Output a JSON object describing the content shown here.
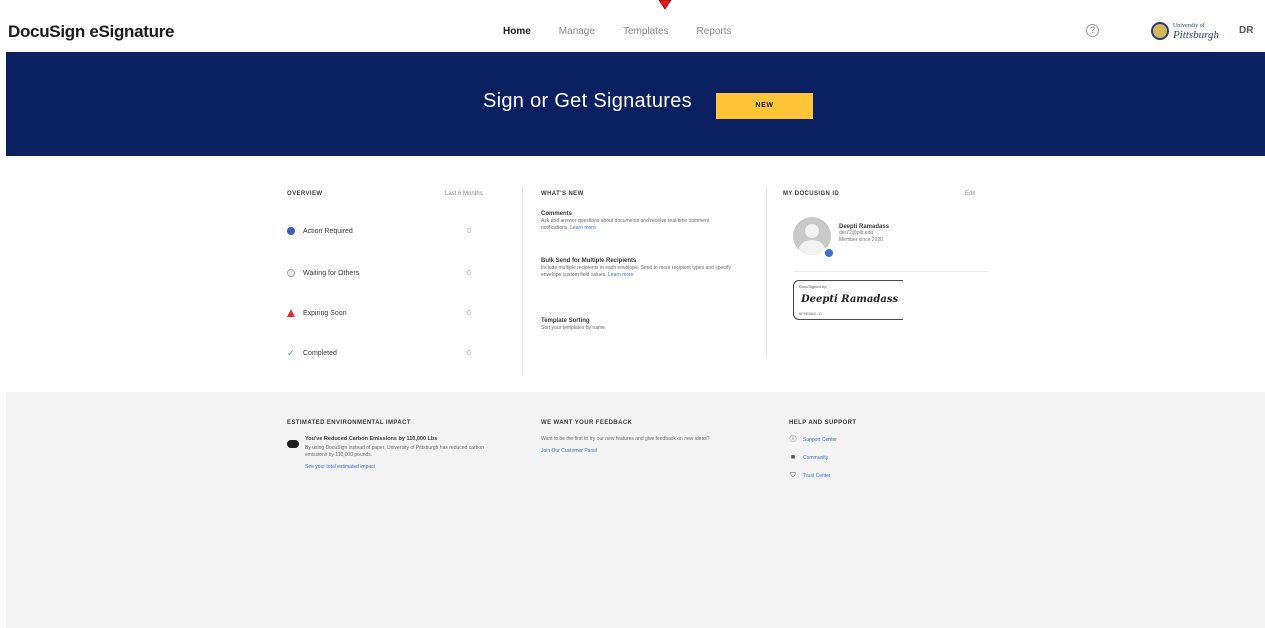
{
  "header": {
    "brand": "DocuSign eSignature",
    "nav": [
      "Home",
      "Manage",
      "Templates",
      "Reports"
    ],
    "active_tab": "Home",
    "help_glyph": "?",
    "org": {
      "line1": "University of",
      "line2": "Pittsburgh"
    },
    "user_initials": "DR"
  },
  "banner": {
    "title": "Sign or Get Signatures",
    "new_button": "NEW",
    "bg_color": "#0b2060",
    "accent_color": "#ffc43a"
  },
  "overview": {
    "title": "OVERVIEW",
    "range": "Last 6 Months",
    "rows": [
      {
        "label": "Action Required",
        "count": "0",
        "icon": "blue-dot-icon"
      },
      {
        "label": "Waiting for Others",
        "count": "0",
        "icon": "grey-dot-icon"
      },
      {
        "label": "Expiring Soon",
        "count": "0",
        "icon": "warning-triangle-icon"
      },
      {
        "label": "Completed",
        "count": "0",
        "icon": "check-icon"
      }
    ]
  },
  "whats_new": {
    "title": "WHAT'S NEW",
    "items": [
      {
        "title": "Comments",
        "desc": "Ask and answer questions about documents and receive real-time comment notifications.",
        "link": "Learn more"
      },
      {
        "title": "Bulk Send for Multiple Recipients",
        "desc": "Include multiple recipients in each envelope. Send to more recipient types and specify envelope custom field values.",
        "link": "Learn more"
      },
      {
        "title": "Template Sorting",
        "desc": "Sort your templates by name.",
        "link": ""
      }
    ]
  },
  "my_id": {
    "title": "MY DOCUSIGN ID",
    "edit": "Edit",
    "name": "Deepti Ramadass",
    "email": "der72@pitt.edu",
    "since": "Member since 2020",
    "sig_by": "DocuSigned by:",
    "signature": "Deepti Ramadass",
    "sig_code": "6F9E8A4...D"
  },
  "footer": {
    "env": {
      "title": "ESTIMATED ENVIRONMENTAL IMPACT",
      "headline": "You've Reduced Carbon Emissions by 110,000 Lbs",
      "desc": "By using DocuSign instead of paper, University of Pittsburgh has reduced carbon emissions by 110,000 pounds.",
      "link": "See your total estimated impact"
    },
    "feedback": {
      "title": "WE WANT YOUR FEEDBACK",
      "desc": "Want to be the first to try our new features and give feedback on new ideas?",
      "link": "Join Our Customer Panel"
    },
    "help": {
      "title": "HELP AND SUPPORT",
      "links": [
        {
          "label": "Support Center",
          "icon": "question-circle-icon"
        },
        {
          "label": "Community",
          "icon": "chat-icon"
        },
        {
          "label": "Trust Center",
          "icon": "shield-icon"
        }
      ]
    }
  }
}
